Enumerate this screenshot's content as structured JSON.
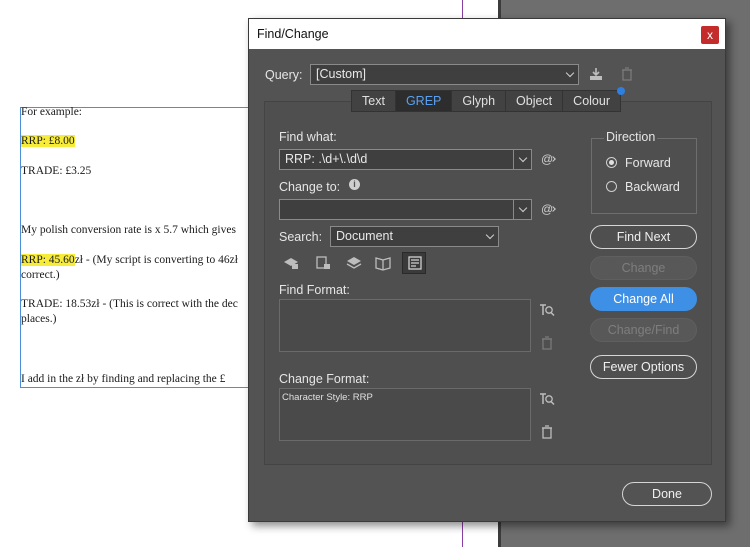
{
  "document": {
    "lines": [
      {
        "text": "For example:"
      },
      {
        "text": "RRP: £8.00"
      },
      {
        "text": "TRADE: £3.25"
      },
      {
        "text": "My polish conversion rate is x 5.7 which gives"
      },
      {
        "text_hl": "RRP: 45.60",
        "text_rest": "zł  - (My script is converting to 46zł"
      },
      {
        "text": "correct.)"
      },
      {
        "text": "TRADE: 18.53zł  - (This is correct with the dec"
      },
      {
        "text": "places.)"
      },
      {
        "text": "I add in the zł by finding and replacing the £"
      }
    ]
  },
  "dialog": {
    "title": "Find/Change",
    "close": "x",
    "query": {
      "label": "Query:",
      "value": "[Custom]"
    },
    "tabs": [
      "Text",
      "GREP",
      "Glyph",
      "Object",
      "Colour"
    ],
    "active_tab": "GREP",
    "find_what": {
      "label": "Find what:",
      "value": "RRP: .\\d+\\.\\d\\d"
    },
    "change_to": {
      "label": "Change to:",
      "value": ""
    },
    "search": {
      "label": "Search:",
      "value": "Document"
    },
    "find_format": {
      "label": "Find Format:",
      "value": ""
    },
    "change_format": {
      "label": "Change Format:",
      "value": "Character Style: RRP"
    },
    "direction": {
      "label": "Direction",
      "forward": "Forward",
      "backward": "Backward",
      "selected": "Forward"
    },
    "buttons": {
      "find_next": "Find Next",
      "change": "Change",
      "change_all": "Change All",
      "change_find": "Change/Find",
      "fewer_options": "Fewer Options",
      "done": "Done"
    },
    "special_char_symbol": "@",
    "info_symbol": "i",
    "colors": {
      "accent": "#3d90e6",
      "dialog_bg": "#535353",
      "highlight": "#f7ec3a",
      "close": "#c42b2b"
    }
  }
}
